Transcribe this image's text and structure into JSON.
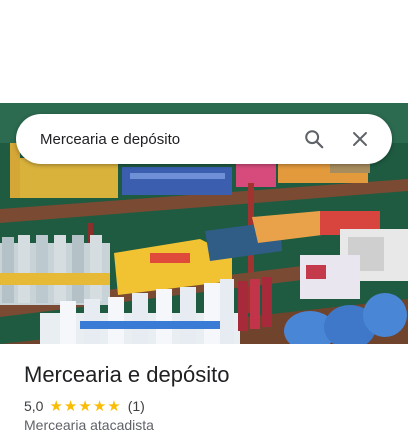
{
  "search": {
    "query": "Mercearia e depósito",
    "search_icon": "search-icon",
    "close_icon": "close-icon"
  },
  "place": {
    "name": "Mercearia e depósito",
    "rating_value": "5,0",
    "rating": 5,
    "rating_max": 5,
    "reviews_count": "(1)",
    "category": "Mercearia atacadista"
  },
  "photo": {
    "subject": "store shelves photo"
  },
  "colors": {
    "star": "#fbbc04",
    "icon": "#5f6368",
    "title_text": "#202124"
  }
}
